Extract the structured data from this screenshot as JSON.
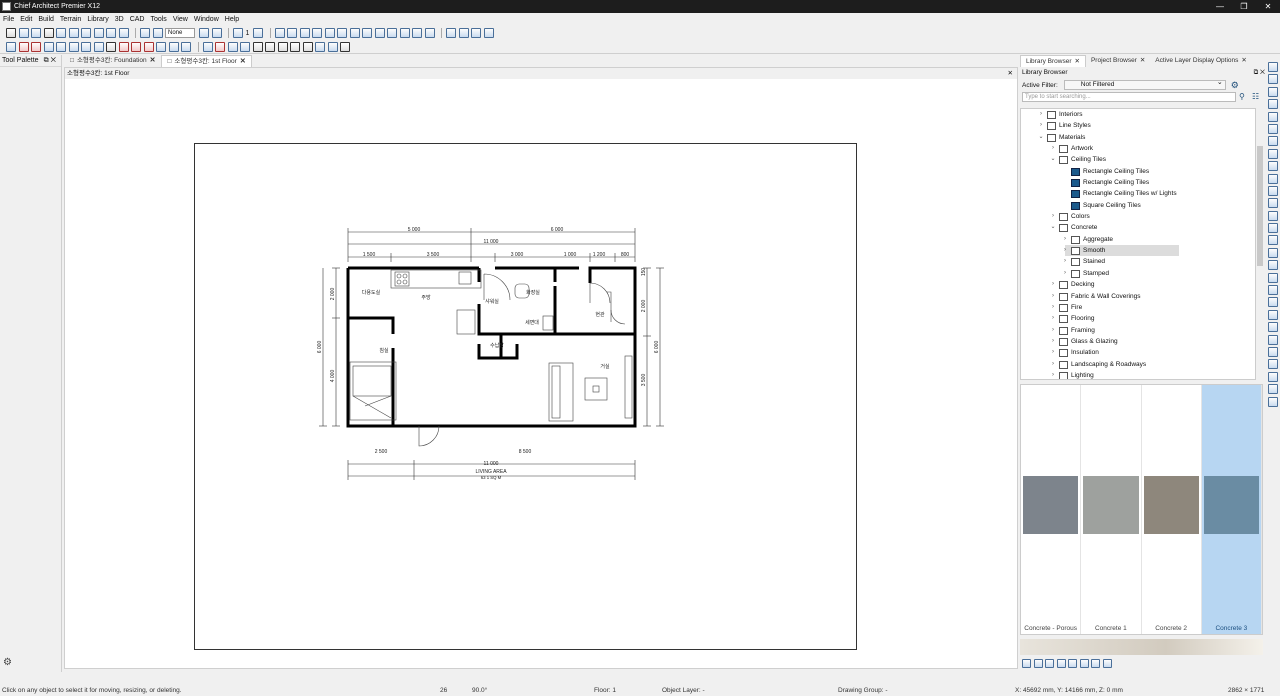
{
  "app": {
    "title": "Chief Architect Premier X12"
  },
  "menu": [
    "File",
    "Edit",
    "Build",
    "Terrain",
    "Library",
    "3D",
    "CAD",
    "Tools",
    "View",
    "Window",
    "Help"
  ],
  "toolbar": {
    "layer_combo": "None",
    "floor_num": "1"
  },
  "tool_palette": {
    "title": "Tool Palette"
  },
  "tabs": [
    {
      "label": "소형평수3칸: Foundation",
      "active": false
    },
    {
      "label": "소형평수3칸: 1st Floor",
      "active": true
    }
  ],
  "view_header": "소형평수3칸: 1st Floor",
  "plan": {
    "dims_top1": [
      "5 000",
      "6 000"
    ],
    "dims_top2": [
      "11 000"
    ],
    "dims_top3": [
      "1 500",
      "3 500",
      "3 000",
      "1 000",
      "1 200",
      "800"
    ],
    "dims_left": [
      "2 000",
      "6 000",
      "4 000"
    ],
    "dims_right": [
      "2 000",
      "6 000",
      "3 500",
      "150"
    ],
    "dims_bottom1": [
      "2 500",
      "8 500"
    ],
    "dims_bottom2": [
      "11 000"
    ],
    "rooms": [
      "다용도실",
      "주방",
      "화장실",
      "샤워실",
      "세면대",
      "침실",
      "수납장",
      "현관",
      "거실"
    ],
    "area_label": "LIVING AREA",
    "area_value": "63 1 SQ M"
  },
  "library": {
    "tabs": [
      "Library Browser",
      "Project Browser",
      "Active Layer Display Options"
    ],
    "header": "Library Browser",
    "filter_label": "Active Filter:",
    "filter_value": "Not Filtered",
    "search_placeholder": "Type to start searching...",
    "tree": [
      {
        "label": "Interiors",
        "level": 1,
        "expanded": false
      },
      {
        "label": "Line Styles",
        "level": 1,
        "expanded": false
      },
      {
        "label": "Materials",
        "level": 1,
        "expanded": true
      },
      {
        "label": "Artwork",
        "level": 2,
        "expanded": false
      },
      {
        "label": "Ceiling Tiles",
        "level": 2,
        "expanded": true
      },
      {
        "label": "Rectangle Ceiling Tiles",
        "level": 3,
        "swatch": true
      },
      {
        "label": "Rectangle Ceiling Tiles",
        "level": 3,
        "swatch": true
      },
      {
        "label": "Rectangle Ceiling Tiles w/ Lights",
        "level": 3,
        "swatch": true
      },
      {
        "label": "Square Ceiling Tiles",
        "level": 3,
        "swatch": true
      },
      {
        "label": "Colors",
        "level": 2,
        "expanded": false
      },
      {
        "label": "Concrete",
        "level": 2,
        "expanded": true
      },
      {
        "label": "Aggregate",
        "level": 3,
        "expanded": false
      },
      {
        "label": "Smooth",
        "level": 3,
        "expanded": false,
        "selected": true
      },
      {
        "label": "Stained",
        "level": 3,
        "expanded": false
      },
      {
        "label": "Stamped",
        "level": 3,
        "expanded": false
      },
      {
        "label": "Decking",
        "level": 2,
        "expanded": false
      },
      {
        "label": "Fabric & Wall Coverings",
        "level": 2,
        "expanded": false
      },
      {
        "label": "Fire",
        "level": 2,
        "expanded": false
      },
      {
        "label": "Flooring",
        "level": 2,
        "expanded": false
      },
      {
        "label": "Framing",
        "level": 2,
        "expanded": false
      },
      {
        "label": "Glass & Glazing",
        "level": 2,
        "expanded": false
      },
      {
        "label": "Insulation",
        "level": 2,
        "expanded": false
      },
      {
        "label": "Landscaping & Roadways",
        "level": 2,
        "expanded": false
      },
      {
        "label": "Lighting",
        "level": 2,
        "expanded": false
      }
    ],
    "swatches": [
      {
        "label": "Concrete - Porous",
        "color": "#7d848c",
        "selected": false
      },
      {
        "label": "Concrete 1",
        "color": "#9ea19e",
        "selected": false
      },
      {
        "label": "Concrete 2",
        "color": "#8e877c",
        "selected": false
      },
      {
        "label": "Concrete 3",
        "color": "#6a8ca3",
        "selected": true
      }
    ]
  },
  "status": {
    "hint": "Click on any object to select it for moving, resizing, or deleting.",
    "count": "26",
    "angle": "90.0°",
    "floor": "Floor: 1",
    "layer": "Object Layer: -",
    "group": "Drawing Group: -",
    "coords": "X: 45692 mm, Y: 14166 mm, Z: 0 mm",
    "size": "2862 × 1771"
  },
  "colors": {
    "accent": "#1b5a8c",
    "selected_bg": "#b7d6f2"
  }
}
